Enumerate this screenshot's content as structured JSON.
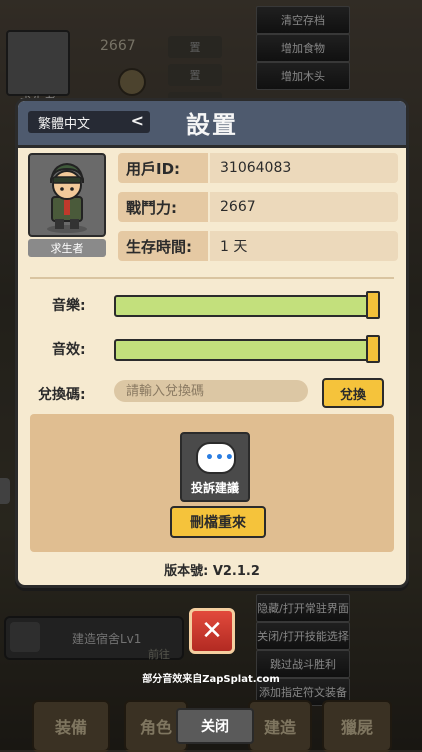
{
  "background": {
    "player_name": "求生者",
    "power_value": "2667",
    "debug_menu_top": [
      "清空存档",
      "增加食物",
      "增加木头"
    ],
    "debug_menu_bottom": [
      "隐藏/打开常驻界面",
      "关闭/打开技能选择",
      "跳过战斗胜利",
      "添加指定符文装备"
    ],
    "side_small_top": [
      "置",
      "置",
      "置"
    ],
    "build_text": "建造宿舍Lv1",
    "goto_text": "前往",
    "bottom_tabs": [
      "装備",
      "角色",
      "建造",
      "獵屍"
    ],
    "bottom_close": "关闭",
    "zapsplat_credit": "部分音效来自ZapSplat.com"
  },
  "panel": {
    "language": "繁體中文",
    "language_chevron": "<",
    "title": "設置",
    "portrait_label": "求生者",
    "info": [
      {
        "key": "用戶ID:",
        "value": "31064083"
      },
      {
        "key": "戰鬥力:",
        "value": "2667"
      },
      {
        "key": "生存時間:",
        "value": "1 天"
      }
    ],
    "music_label": "音樂:",
    "music_level": 1.0,
    "sfx_label": "音效:",
    "sfx_level": 1.0,
    "redeem_label": "兌換碼:",
    "redeem_placeholder": "請輸入兌換碼",
    "redeem_button": "兌換",
    "feedback_label": "投訴建議",
    "feedback_icon": "chat-bubble-icon",
    "delete_button": "刪檔重來",
    "version": "版本號: V2.1.2"
  },
  "close_icon": "close-x-icon",
  "colors": {
    "panel_bg": "#f6ead0",
    "header_bg": "#4e5a6e",
    "slider_fill": "#c3e07c",
    "button_yellow": "#f5c33b",
    "close_red": "#d23a2e"
  }
}
